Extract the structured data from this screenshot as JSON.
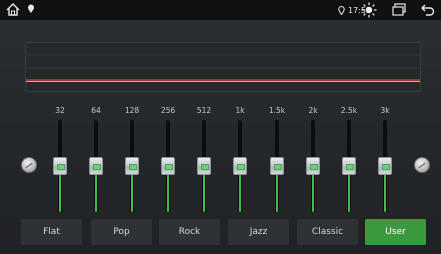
{
  "statusbar": {
    "time": "17:52",
    "icons": {
      "home": "home-icon",
      "signal": "location-pin-icon",
      "location": "location-icon",
      "brightness": "brightness-icon",
      "windows": "recent-apps-icon",
      "back": "back-icon"
    }
  },
  "equalizer": {
    "bands": [
      {
        "freq": "32",
        "gain": "0"
      },
      {
        "freq": "64",
        "gain": "0"
      },
      {
        "freq": "128",
        "gain": "0"
      },
      {
        "freq": "256",
        "gain": "0"
      },
      {
        "freq": "512",
        "gain": "0"
      },
      {
        "freq": "1k",
        "gain": "0"
      },
      {
        "freq": "1.5k",
        "gain": "0"
      },
      {
        "freq": "2k",
        "gain": "0"
      },
      {
        "freq": "2.5k",
        "gain": "0"
      },
      {
        "freq": "3k",
        "gain": "0"
      }
    ]
  },
  "presets": [
    {
      "label": "Flat"
    },
    {
      "label": "Pop"
    },
    {
      "label": "Rock"
    },
    {
      "label": "Jazz"
    },
    {
      "label": "Classic"
    },
    {
      "label": "User"
    }
  ],
  "active_preset": "User",
  "colors": {
    "accent": "#3b9a3f",
    "slider_fill": "#3fbf4a",
    "curve_red": "#c8332e",
    "curve_yellow": "#d8b53a"
  }
}
